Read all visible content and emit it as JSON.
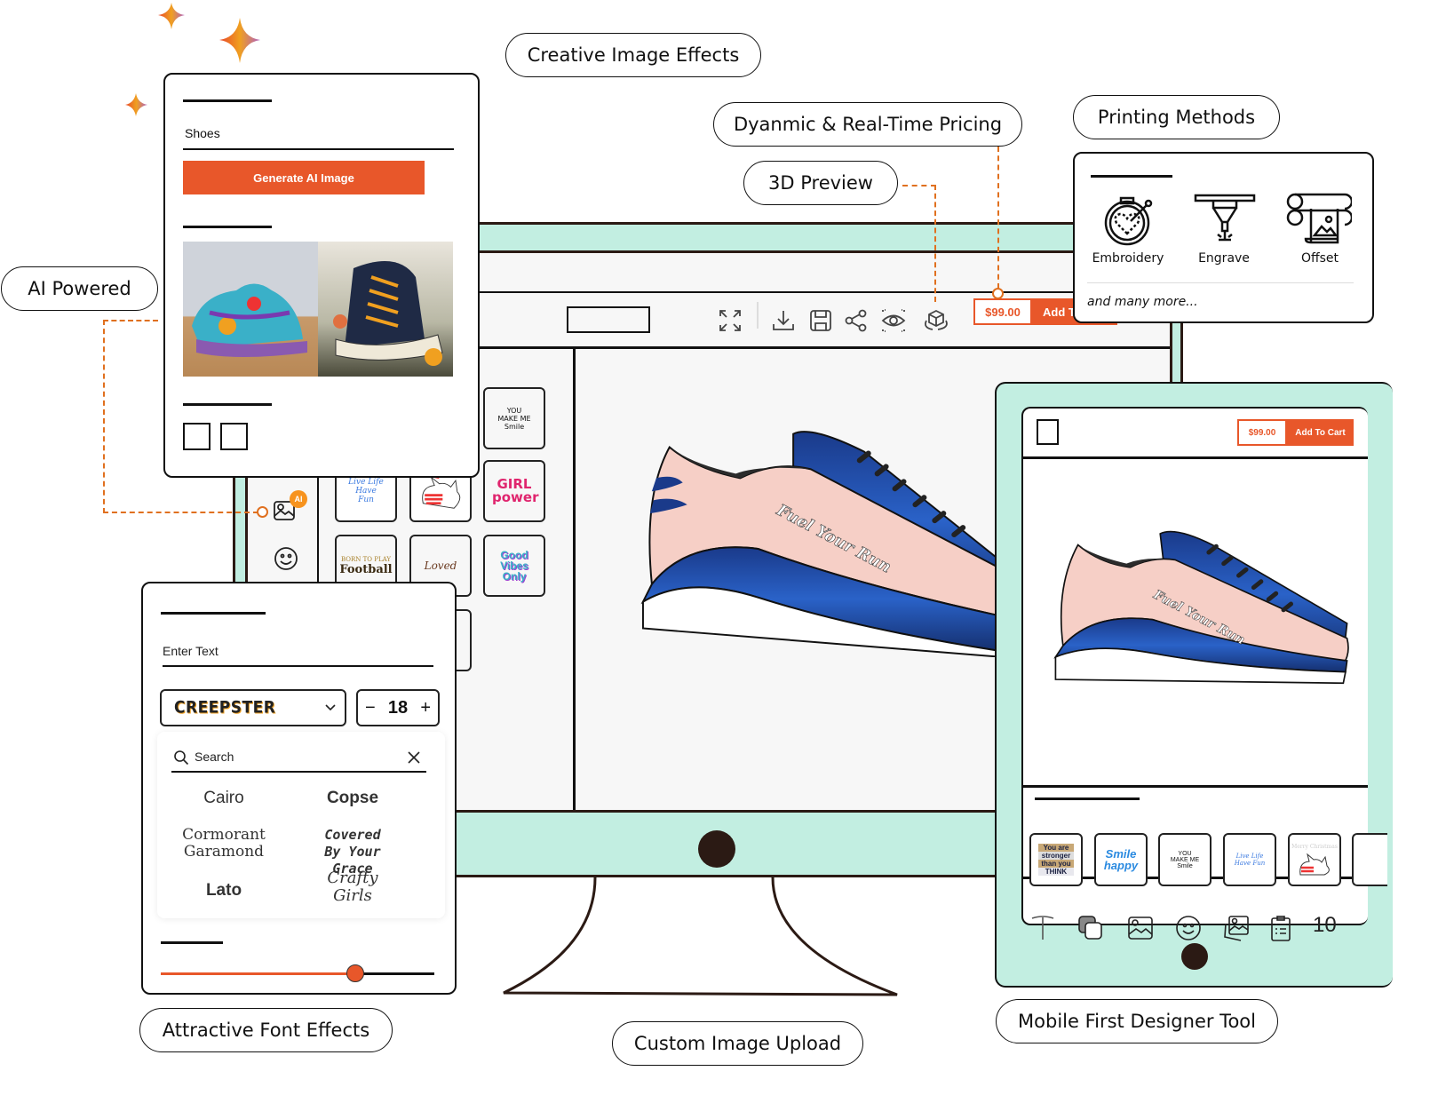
{
  "feature_labels": {
    "creative_image_effects": "Creative Image Effects",
    "dynamic_pricing": "Dyanmic & Real-Time Pricing",
    "preview_3d": "3D Preview",
    "printing_methods": "Printing Methods",
    "ai_powered": "AI Powered",
    "attractive_font_effects": "Attractive Font Effects",
    "custom_image_upload": "Custom Image Upload",
    "mobile_first": "Mobile First Designer Tool"
  },
  "ai_panel": {
    "prompt_value": "Shoes",
    "generate_button": "Generate AI Image",
    "results": [
      "Painted colorful shoes",
      "Floral high-top sneakers"
    ]
  },
  "printing_panel": {
    "methods": [
      {
        "label": "Embroidery",
        "icon": "embroidery-hoop-icon"
      },
      {
        "label": "Engrave",
        "icon": "laser-engrave-icon"
      },
      {
        "label": "Offset",
        "icon": "offset-print-icon"
      }
    ],
    "more_text": "and many more..."
  },
  "desktop": {
    "toolbar_icons": [
      "fullscreen-icon",
      "download-icon",
      "save-icon",
      "share-icon",
      "eye-preview-icon",
      "3d-cube-icon"
    ],
    "price": "$99.00",
    "add_to_cart": "Add To Cart",
    "product_text": "Fuel Your Run",
    "side_icons": [
      "ai-image-icon",
      "emoji-icon"
    ],
    "ai_badge": "AI",
    "clipart": [
      {
        "name": "you-make-me-smile",
        "text": "YOU MAKE ME Smile"
      },
      {
        "name": "live-life-have-fun",
        "text": "Live Life Have Fun"
      },
      {
        "name": "christmas-cats",
        "text": "Cats"
      },
      {
        "name": "girl-power",
        "text": "GIRL power"
      },
      {
        "name": "born-to-play-football",
        "text_small": "BORN TO PLAY",
        "text": "Football"
      },
      {
        "name": "loved",
        "text": "Loved"
      },
      {
        "name": "good-vibes-only",
        "text": "Good Vibes Only"
      }
    ]
  },
  "font_panel": {
    "text_placeholder": "Enter Text",
    "selected_font": "CREEPSTER",
    "size": "18",
    "minus": "−",
    "plus": "+",
    "search_placeholder": "Search",
    "fonts": [
      "Cairo",
      "Copse",
      "Cormorant Garamond",
      "Covered By Your Grace",
      "Lato",
      "Crafty Girls"
    ],
    "slider_value": 0.71
  },
  "mobile": {
    "price": "$99.00",
    "add_to_cart": "Add To Cart",
    "product_text": "Fuel Your Run",
    "clipart": [
      {
        "name": "you-are-stronger",
        "text": "You are stronger than you THINK"
      },
      {
        "name": "smile-be-happy",
        "text": "Smile happy"
      },
      {
        "name": "you-make-me-smile",
        "text": "YOU MAKE ME Smile"
      },
      {
        "name": "live-life-have-fun",
        "text": "Live Life Have Fun"
      },
      {
        "name": "merry-christmas",
        "text": "Merry Christmas"
      }
    ],
    "bottom_icons": [
      "text-icon",
      "layers-icon",
      "image-icon",
      "emoji-icon",
      "gallery-icon",
      "clipboard-list-icon"
    ],
    "count": "10"
  },
  "colors": {
    "accent": "#e8572a",
    "mint": "#c2eee1",
    "dark": "#2b1a14",
    "dash": "#e0701f"
  }
}
